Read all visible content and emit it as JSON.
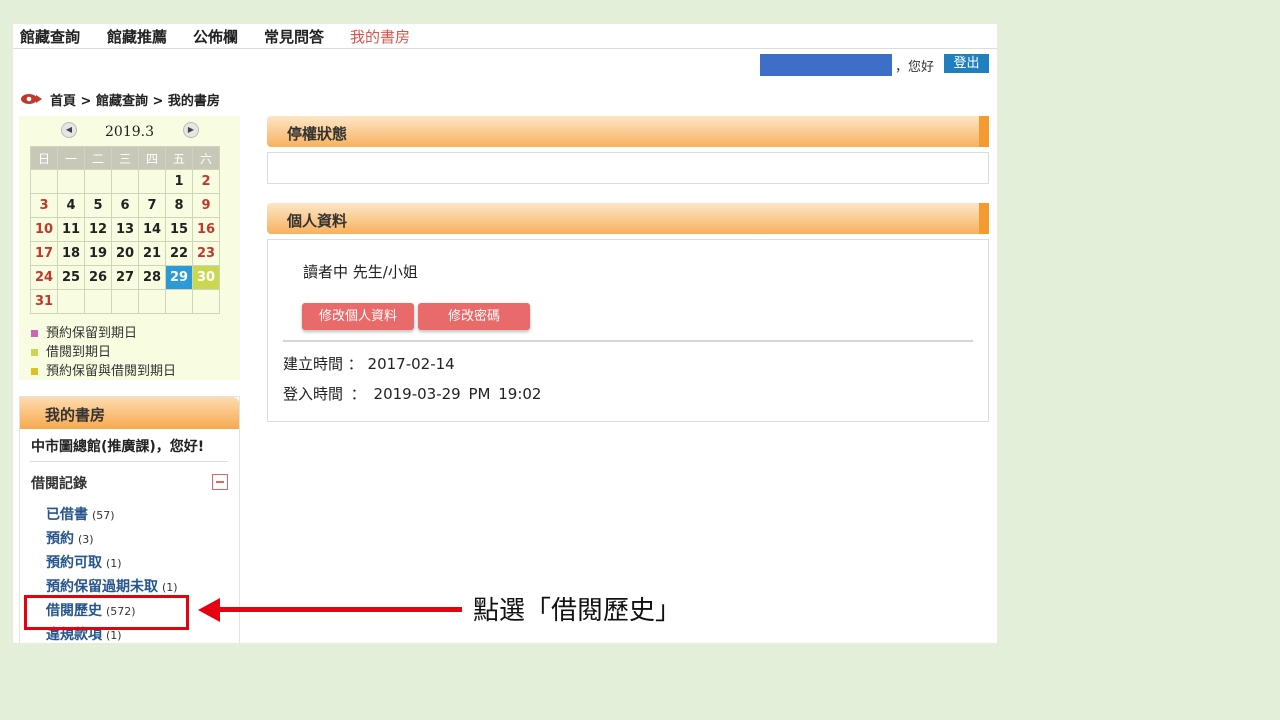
{
  "topnav": {
    "items": [
      "館藏查詢",
      "館藏推薦",
      "公佈欄",
      "常見問答",
      "我的書房"
    ]
  },
  "user_bar": {
    "greeting": "，您好",
    "logout": "登出"
  },
  "breadcrumb": {
    "text": "首頁 > 館藏查詢 > 我的書房"
  },
  "calendar": {
    "title": "2019.3",
    "weekdays": [
      "日",
      "一",
      "二",
      "三",
      "四",
      "五",
      "六"
    ],
    "weeks": [
      [
        "",
        "",
        "",
        "",
        "",
        "1",
        "2"
      ],
      [
        "3",
        "4",
        "5",
        "6",
        "7",
        "8",
        "9"
      ],
      [
        "10",
        "11",
        "12",
        "13",
        "14",
        "15",
        "16"
      ],
      [
        "17",
        "18",
        "19",
        "20",
        "21",
        "22",
        "23"
      ],
      [
        "24",
        "25",
        "26",
        "27",
        "28",
        "29",
        "30"
      ],
      [
        "31",
        "",
        "",
        "",
        "",
        "",
        ""
      ]
    ],
    "today": "29",
    "highlight": "30",
    "legend": [
      {
        "label": "預約保留到期日",
        "color": "#d264b6"
      },
      {
        "label": "借閱到期日",
        "color": "#c9d850"
      },
      {
        "label": "預約保留與借閱到期日",
        "color": "#e0c020"
      }
    ]
  },
  "sidebar": {
    "title": "我的書房",
    "user": "中市圖總館(推廣課)，您好!",
    "section": "借閱記錄",
    "items": [
      {
        "label": "已借書",
        "count": "(57)"
      },
      {
        "label": "預約",
        "count": "(3)"
      },
      {
        "label": "預約可取",
        "count": "(1)"
      },
      {
        "label": "預約保留過期未取",
        "count": "(1)"
      },
      {
        "label": "借閱歷史",
        "count": "(572)"
      },
      {
        "label": "違規款項",
        "count": "(1)"
      }
    ]
  },
  "panels": {
    "suspension": {
      "title": "停權狀態"
    },
    "profile": {
      "title": "個人資料",
      "reader": "讀者中 先生/小姐",
      "edit_button": "修改個人資料",
      "password_button": "修改密碼",
      "created": "建立時間 ： 2017-02-14",
      "login": "登入時間 ： 2019-03-29 PM 19:02"
    }
  },
  "annotation": {
    "text": "點選「借閱歷史」"
  },
  "colors": {
    "accent_red": "#e60012",
    "panel_orange": "#f7b15e",
    "today_blue": "#2d9ad8"
  }
}
